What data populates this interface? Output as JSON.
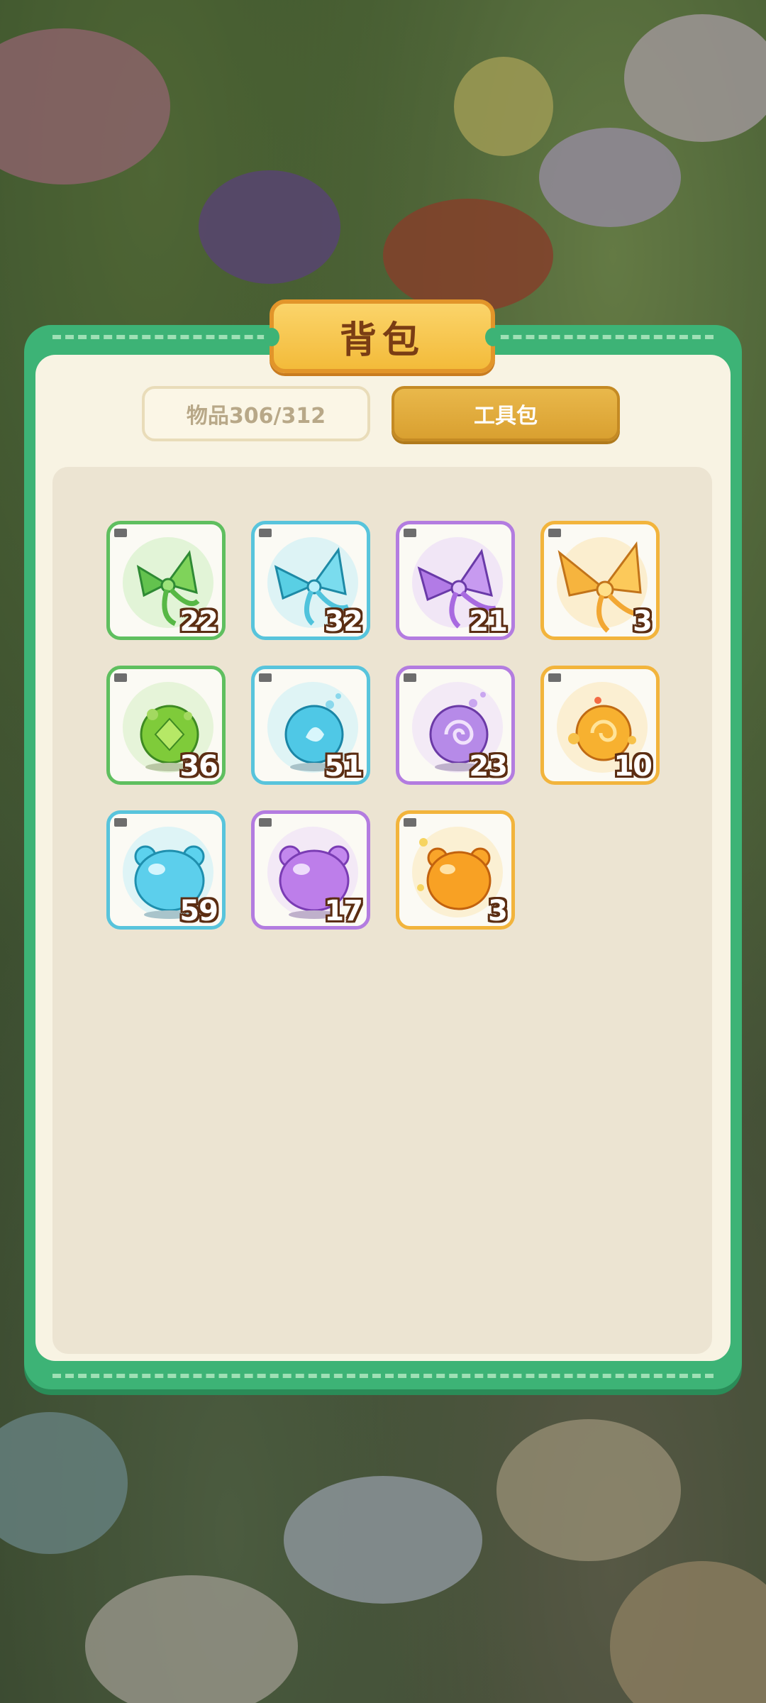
{
  "window": {
    "title": "背包"
  },
  "tabs": [
    {
      "label": "物品306/312",
      "selected": false
    },
    {
      "label": "工具包",
      "selected": true
    }
  ],
  "items": [
    {
      "name": "green-bow-icon",
      "rarity": "green",
      "count": "22"
    },
    {
      "name": "cyan-bow-icon",
      "rarity": "cyan",
      "count": "32"
    },
    {
      "name": "purple-bow-icon",
      "rarity": "purple",
      "count": "21"
    },
    {
      "name": "golden-bow-icon",
      "rarity": "orange",
      "count": "3"
    },
    {
      "name": "green-orb-icon",
      "rarity": "green",
      "count": "36"
    },
    {
      "name": "cyan-orb-icon",
      "rarity": "cyan",
      "count": "51"
    },
    {
      "name": "purple-orb-icon",
      "rarity": "purple",
      "count": "23"
    },
    {
      "name": "golden-orb-icon",
      "rarity": "orange",
      "count": "10"
    },
    {
      "name": "cyan-jelly-icon",
      "rarity": "cyan",
      "count": "59"
    },
    {
      "name": "purple-jelly-icon",
      "rarity": "purple",
      "count": "17"
    },
    {
      "name": "orange-jelly-icon",
      "rarity": "orange",
      "count": "3"
    }
  ],
  "colors": {
    "panel_frame": "#3db376",
    "panel_inner": "#f8f3e3",
    "title_plate": "#f3bb3a",
    "tab_active": "#d9a030",
    "green": "#5fbf5f",
    "cyan": "#58c4dc",
    "purple": "#b37ce0",
    "orange": "#f2b43c"
  }
}
